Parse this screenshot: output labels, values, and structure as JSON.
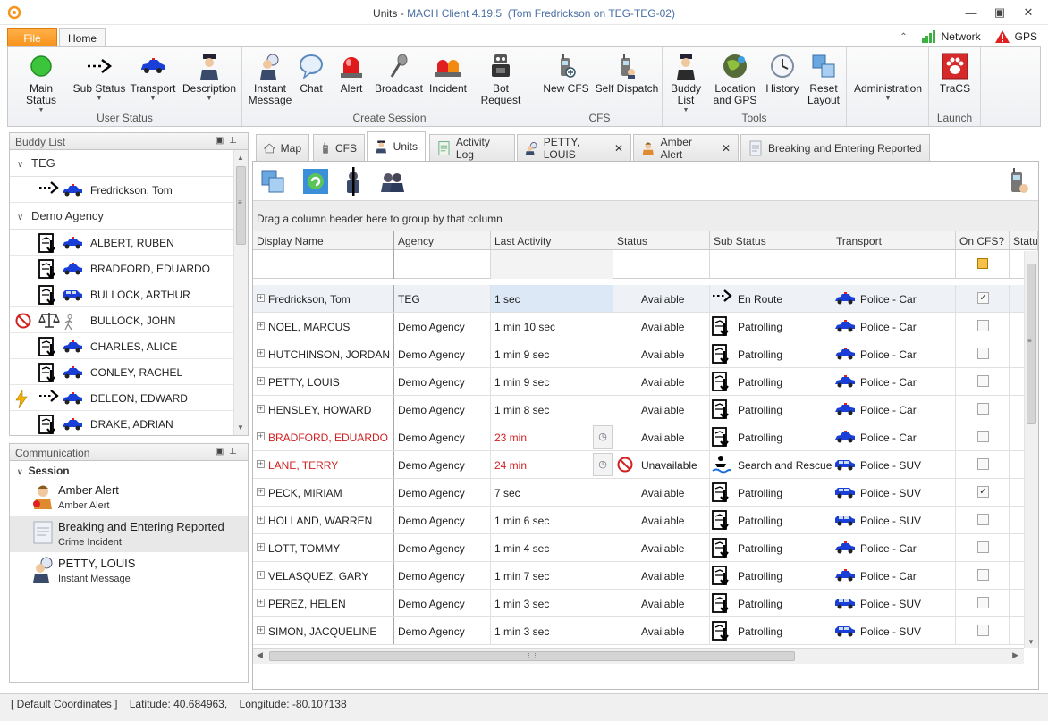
{
  "window": {
    "title_prefix": "Units - ",
    "title_app": "MACH Client 4.19.5",
    "title_user": "(Tom Fredrickson on TEG-TEG-02)"
  },
  "ribbon_tabs": {
    "file": "File",
    "home": "Home"
  },
  "indicators": {
    "network": "Network",
    "gps": "GPS"
  },
  "ribbon": {
    "user_status": {
      "label": "User Status",
      "main_status": "Main Status",
      "sub_status": "Sub Status",
      "transport": "Transport",
      "description": "Description"
    },
    "create_session": {
      "label": "Create Session",
      "instant_message_1": "Instant",
      "instant_message_2": "Message",
      "chat": "Chat",
      "alert": "Alert",
      "broadcast": "Broadcast",
      "incident": "Incident",
      "bot_request": "Bot Request"
    },
    "cfs": {
      "label": "CFS",
      "new_cfs": "New CFS",
      "self_dispatch": "Self Dispatch"
    },
    "tools": {
      "label": "Tools",
      "buddy_list_1": "Buddy",
      "buddy_list_2": "List",
      "location_1": "Location",
      "location_2": "and GPS",
      "history": "History",
      "reset_1": "Reset",
      "reset_2": "Layout"
    },
    "administration": "Administration",
    "launch": {
      "label": "Launch",
      "tracs": "TraCS"
    }
  },
  "buddy_list": {
    "title": "Buddy List",
    "groups": [
      {
        "name": "TEG",
        "members": [
          {
            "name": "Fredrickson, Tom",
            "status": "none",
            "sub": "enroute",
            "transport": "car"
          }
        ]
      },
      {
        "name": "Demo Agency",
        "members": [
          {
            "name": "ALBERT, RUBEN",
            "status": "none",
            "sub": "patrol",
            "transport": "car"
          },
          {
            "name": "BRADFORD, EDUARDO",
            "status": "none",
            "sub": "patrol",
            "transport": "car"
          },
          {
            "name": "BULLOCK, ARTHUR",
            "status": "none",
            "sub": "patrol",
            "transport": "suv"
          },
          {
            "name": "BULLOCK, JOHN",
            "status": "unavailable",
            "sub": "court",
            "transport": "walk"
          },
          {
            "name": "CHARLES, ALICE",
            "status": "none",
            "sub": "patrol",
            "transport": "car"
          },
          {
            "name": "CONLEY, RACHEL",
            "status": "none",
            "sub": "patrol",
            "transport": "car"
          },
          {
            "name": "DELEON, EDWARD",
            "status": "lightning",
            "sub": "enroute",
            "transport": "car"
          },
          {
            "name": "DRAKE, ADRIAN",
            "status": "none",
            "sub": "patrol",
            "transport": "car"
          }
        ]
      }
    ]
  },
  "communication": {
    "title": "Communication",
    "session_label": "Session",
    "items": [
      {
        "title": "Amber Alert",
        "subtitle": "Amber Alert",
        "icon": "amber-alert-icon"
      },
      {
        "title": "Breaking and Entering Reported",
        "subtitle": "Crime Incident",
        "icon": "incident-icon"
      },
      {
        "title": "PETTY, LOUIS",
        "subtitle": "Instant Message",
        "icon": "instant-message-icon"
      }
    ]
  },
  "doc_tabs": [
    {
      "label": "Map",
      "closable": false
    },
    {
      "label": "CFS",
      "closable": false
    },
    {
      "label": "Units",
      "closable": false
    },
    {
      "label": "Activity Log",
      "closable": false
    },
    {
      "label": "PETTY, LOUIS",
      "closable": true
    },
    {
      "label": "Amber Alert",
      "closable": true
    },
    {
      "label": "Breaking and Entering Reported",
      "closable": false
    }
  ],
  "grid": {
    "group_hint": "Drag a column header here to group by that column",
    "columns": [
      "Display Name",
      "Agency",
      "Last Activity",
      "Status",
      "Sub Status",
      "Transport",
      "On CFS?",
      "Statu"
    ],
    "rows": [
      {
        "name": "Fredrickson, Tom",
        "agency": "TEG",
        "last": "1 sec",
        "status": "Available",
        "sub": "En Route",
        "transport": "Police - Car",
        "oncfs": true,
        "red": false,
        "clock": false,
        "unavail": false,
        "subicon": "enroute"
      },
      {
        "name": "NOEL, MARCUS",
        "agency": "Demo Agency",
        "last": "1 min 10 sec",
        "status": "Available",
        "sub": "Patrolling",
        "transport": "Police - Car",
        "oncfs": false,
        "red": false,
        "clock": false,
        "unavail": false,
        "subicon": "patrol"
      },
      {
        "name": "HUTCHINSON, JORDAN",
        "agency": "Demo Agency",
        "last": "1 min 9 sec",
        "status": "Available",
        "sub": "Patrolling",
        "transport": "Police - Car",
        "oncfs": false,
        "red": false,
        "clock": false,
        "unavail": false,
        "subicon": "patrol"
      },
      {
        "name": "PETTY, LOUIS",
        "agency": "Demo Agency",
        "last": "1 min 9 sec",
        "status": "Available",
        "sub": "Patrolling",
        "transport": "Police - Car",
        "oncfs": false,
        "red": false,
        "clock": false,
        "unavail": false,
        "subicon": "patrol"
      },
      {
        "name": "HENSLEY, HOWARD",
        "agency": "Demo Agency",
        "last": "1 min 8 sec",
        "status": "Available",
        "sub": "Patrolling",
        "transport": "Police - Car",
        "oncfs": false,
        "red": false,
        "clock": false,
        "unavail": false,
        "subicon": "patrol"
      },
      {
        "name": "BRADFORD, EDUARDO",
        "agency": "Demo Agency",
        "last": "23 min",
        "status": "Available",
        "sub": "Patrolling",
        "transport": "Police - Car",
        "oncfs": false,
        "red": true,
        "clock": true,
        "unavail": false,
        "subicon": "patrol"
      },
      {
        "name": "LANE, TERRY",
        "agency": "Demo Agency",
        "last": "24 min",
        "status": "Unavailable",
        "sub": "Search and Rescue",
        "transport": "Police - SUV",
        "oncfs": false,
        "red": true,
        "clock": true,
        "unavail": true,
        "subicon": "rescue"
      },
      {
        "name": "PECK, MIRIAM",
        "agency": "Demo Agency",
        "last": "7 sec",
        "status": "Available",
        "sub": "Patrolling",
        "transport": "Police - SUV",
        "oncfs": true,
        "red": false,
        "clock": false,
        "unavail": false,
        "subicon": "patrol"
      },
      {
        "name": "HOLLAND, WARREN",
        "agency": "Demo Agency",
        "last": "1 min 6 sec",
        "status": "Available",
        "sub": "Patrolling",
        "transport": "Police - SUV",
        "oncfs": false,
        "red": false,
        "clock": false,
        "unavail": false,
        "subicon": "patrol"
      },
      {
        "name": "LOTT, TOMMY",
        "agency": "Demo Agency",
        "last": "1 min 4 sec",
        "status": "Available",
        "sub": "Patrolling",
        "transport": "Police - Car",
        "oncfs": false,
        "red": false,
        "clock": false,
        "unavail": false,
        "subicon": "patrol"
      },
      {
        "name": "VELASQUEZ, GARY",
        "agency": "Demo Agency",
        "last": "1 min 7 sec",
        "status": "Available",
        "sub": "Patrolling",
        "transport": "Police - Car",
        "oncfs": false,
        "red": false,
        "clock": false,
        "unavail": false,
        "subicon": "patrol"
      },
      {
        "name": "PEREZ, HELEN",
        "agency": "Demo Agency",
        "last": "1 min 3 sec",
        "status": "Available",
        "sub": "Patrolling",
        "transport": "Police - SUV",
        "oncfs": false,
        "red": false,
        "clock": false,
        "unavail": false,
        "subicon": "patrol"
      },
      {
        "name": "SIMON, JACQUELINE",
        "agency": "Demo Agency",
        "last": "1 min 3 sec",
        "status": "Available",
        "sub": "Patrolling",
        "transport": "Police - SUV",
        "oncfs": false,
        "red": false,
        "clock": false,
        "unavail": false,
        "subicon": "patrol"
      }
    ]
  },
  "statusbar": {
    "coords": "[ Default Coordinates ]",
    "latitude": "Latitude: 40.684963,",
    "longitude": "Longitude: -80.107138"
  },
  "colors": {
    "accent_orange": "#f7941d",
    "red_text": "#d12020",
    "police_blue": "#1a3fd8"
  }
}
